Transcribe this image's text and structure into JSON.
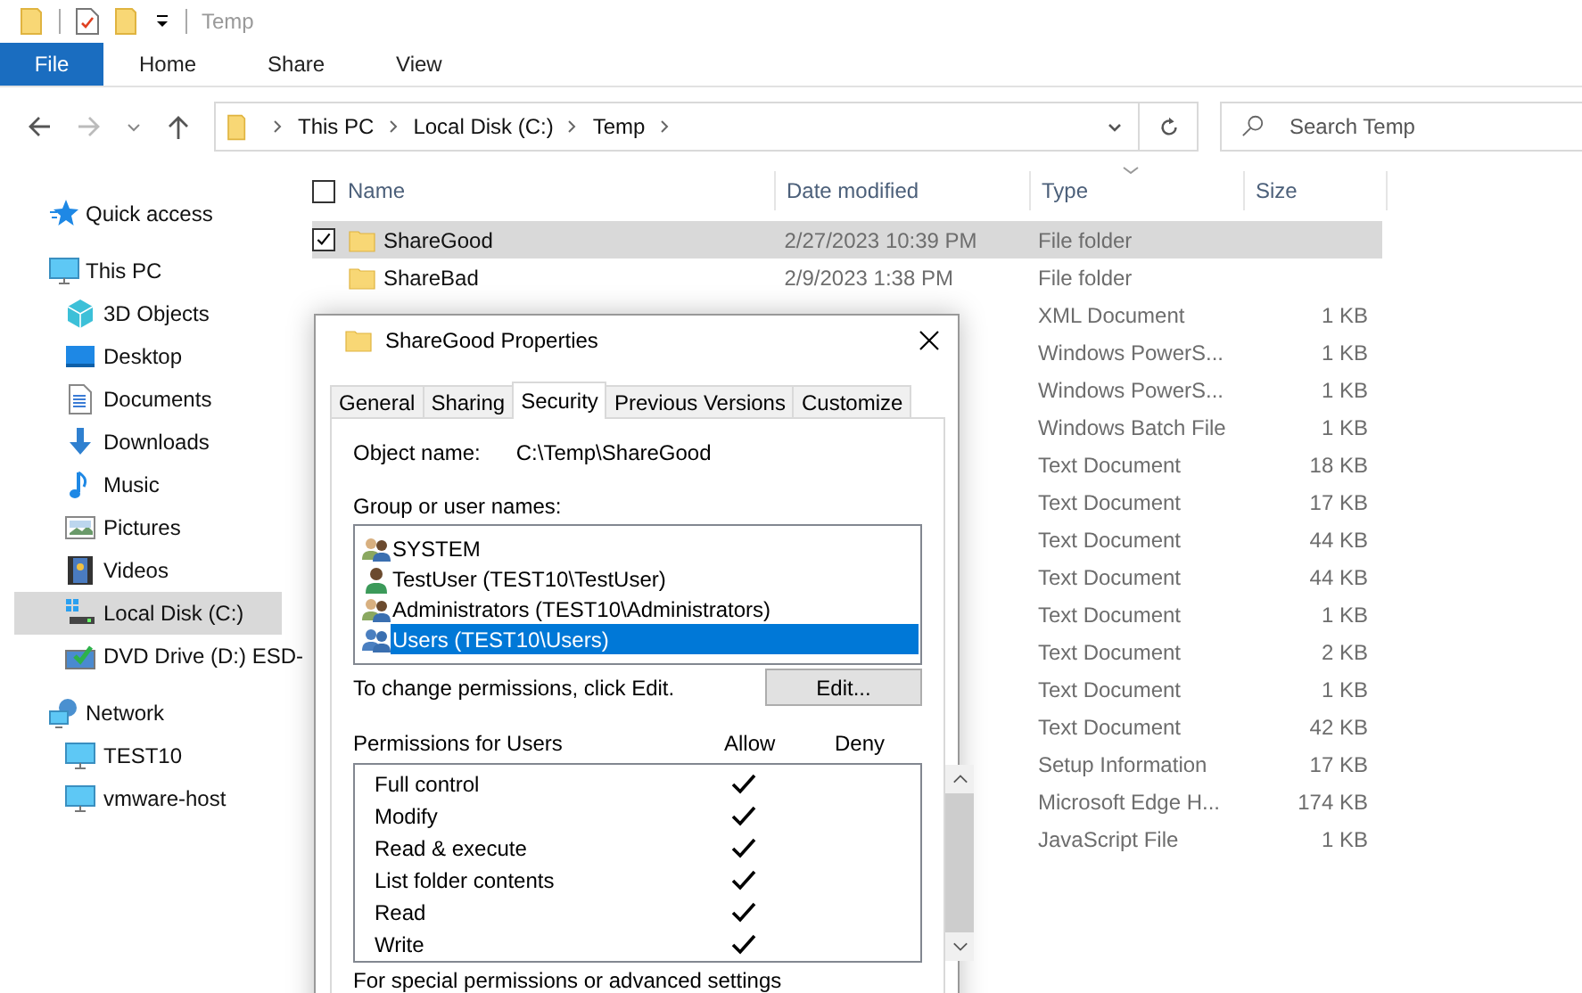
{
  "title_bar": {
    "title": "Temp"
  },
  "ribbon": {
    "tabs": [
      {
        "label": "File",
        "kind": "file"
      },
      {
        "label": "Home",
        "kind": "tab"
      },
      {
        "label": "Share",
        "kind": "tab"
      },
      {
        "label": "View",
        "kind": "tab"
      }
    ]
  },
  "address_bar": {
    "breadcrumbs": [
      "This PC",
      "Local Disk (C:)",
      "Temp"
    ]
  },
  "search": {
    "placeholder": "Search Temp"
  },
  "navigation_pane": {
    "items": [
      {
        "label": "Quick access",
        "kind": "quick-access",
        "selected": false
      },
      {
        "label": "This PC",
        "kind": "pc",
        "selected": false,
        "children": [
          {
            "label": "3D Objects",
            "kind": "objects",
            "selected": false
          },
          {
            "label": "Desktop",
            "kind": "desktop",
            "selected": false
          },
          {
            "label": "Documents",
            "kind": "documents",
            "selected": false
          },
          {
            "label": "Downloads",
            "kind": "downloads",
            "selected": false
          },
          {
            "label": "Music",
            "kind": "music",
            "selected": false
          },
          {
            "label": "Pictures",
            "kind": "pictures",
            "selected": false
          },
          {
            "label": "Videos",
            "kind": "videos",
            "selected": false
          },
          {
            "label": "Local Disk (C:)",
            "kind": "disk",
            "selected": true
          },
          {
            "label": "DVD Drive (D:) ESD-",
            "kind": "dvd",
            "selected": false
          }
        ]
      },
      {
        "label": "Network",
        "kind": "network",
        "selected": false,
        "children": [
          {
            "label": "TEST10",
            "kind": "computer",
            "selected": false
          },
          {
            "label": "vmware-host",
            "kind": "computer",
            "selected": false
          }
        ]
      }
    ]
  },
  "file_list": {
    "columns": [
      "Name",
      "Date modified",
      "Type",
      "Size"
    ],
    "header_checked": false,
    "rows": [
      {
        "name": "ShareGood",
        "kind": "folder",
        "date_modified": "2/27/2023 10:39 PM",
        "type": "File folder",
        "size": "",
        "selected": true,
        "checked": true
      },
      {
        "name": "ShareBad",
        "kind": "folder",
        "date_modified": "2/9/2023 1:38 PM",
        "type": "File folder",
        "size": "",
        "selected": false,
        "checked": false
      },
      {
        "type": "XML Document",
        "size": "1 KB",
        "selected": false,
        "checked": false
      },
      {
        "type": "Windows PowerS...",
        "size": "1 KB",
        "selected": false,
        "checked": false
      },
      {
        "type": "Windows PowerS...",
        "size": "1 KB",
        "selected": false,
        "checked": false
      },
      {
        "type": "Windows Batch File",
        "size": "1 KB",
        "selected": false,
        "checked": false
      },
      {
        "type": "Text Document",
        "size": "18 KB",
        "selected": false,
        "checked": false
      },
      {
        "type": "Text Document",
        "size": "17 KB",
        "selected": false,
        "checked": false
      },
      {
        "type": "Text Document",
        "size": "44 KB",
        "selected": false,
        "checked": false
      },
      {
        "type": "Text Document",
        "size": "44 KB",
        "selected": false,
        "checked": false
      },
      {
        "type": "Text Document",
        "size": "1 KB",
        "selected": false,
        "checked": false
      },
      {
        "type": "Text Document",
        "size": "2 KB",
        "selected": false,
        "checked": false
      },
      {
        "type": "Text Document",
        "size": "1 KB",
        "selected": false,
        "checked": false
      },
      {
        "type": "Text Document",
        "size": "42 KB",
        "selected": false,
        "checked": false
      },
      {
        "type": "Setup Information",
        "size": "17 KB",
        "selected": false,
        "checked": false
      },
      {
        "type": "Microsoft Edge H...",
        "size": "174 KB",
        "selected": false,
        "checked": false
      },
      {
        "type": "JavaScript File",
        "size": "1 KB",
        "selected": false,
        "checked": false
      }
    ]
  },
  "dialog": {
    "title": "ShareGood Properties",
    "tabs": [
      {
        "label": "General",
        "selected": false
      },
      {
        "label": "Sharing",
        "selected": false
      },
      {
        "label": "Security",
        "selected": true
      },
      {
        "label": "Previous Versions",
        "selected": false
      },
      {
        "label": "Customize",
        "selected": false
      }
    ],
    "object_name_label": "Object name:",
    "object_name": "C:\\Temp\\ShareGood",
    "group_label": "Group or user names:",
    "principals": [
      {
        "name": "SYSTEM",
        "kind": "group",
        "selected": false
      },
      {
        "name": "TestUser (TEST10\\TestUser)",
        "kind": "user",
        "selected": false
      },
      {
        "name": "Administrators (TEST10\\Administrators)",
        "kind": "group",
        "selected": false
      },
      {
        "name": "Users (TEST10\\Users)",
        "kind": "users",
        "selected": true
      }
    ],
    "edit_hint": "To change permissions, click Edit.",
    "edit_button": "Edit...",
    "permissions_label": "Permissions for Users",
    "allow_header": "Allow",
    "deny_header": "Deny",
    "permissions": [
      {
        "name": "Full control",
        "allow": true,
        "deny": false
      },
      {
        "name": "Modify",
        "allow": true,
        "deny": false
      },
      {
        "name": "Read & execute",
        "allow": true,
        "deny": false
      },
      {
        "name": "List folder contents",
        "allow": true,
        "deny": false
      },
      {
        "name": "Read",
        "allow": true,
        "deny": false
      },
      {
        "name": "Write",
        "allow": true,
        "deny": false
      }
    ],
    "footer_text": "For special permissions or advanced settings"
  }
}
